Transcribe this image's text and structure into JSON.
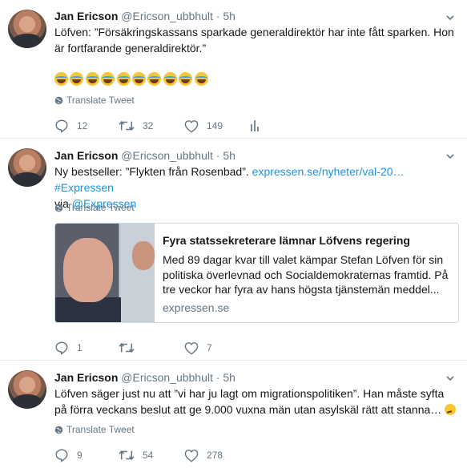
{
  "tweets": [
    {
      "fullname": "Jan Ericson",
      "username": "@Ericson_ubbhult",
      "separator": "·",
      "time": "5h",
      "text": "Löfven: ”Försäkringskassans sparkade generaldirektör har inte fått sparken. Hon är fortfarande generaldirektör.”",
      "emoji_count": 10,
      "translate": "Translate Tweet",
      "replies": "12",
      "retweets": "32",
      "likes": "149"
    },
    {
      "fullname": "Jan Ericson",
      "username": "@Ericson_ubbhult",
      "separator": "·",
      "time": "5h",
      "text_prefix": "Ny bestseller: ”Flykten från Rosenbad”. ",
      "link1": "expressen.se/nyheter/val-20…",
      "hashtag": "#Expressen",
      "text_via": "via ",
      "mention": "@Expressen",
      "translate": "Translate Tweet",
      "card": {
        "title": "Fyra statssekreterare lämnar Löfvens regering",
        "description": "Med 89 dagar kvar till valet kämpar Stefan Löfven för sin politiska överlevnad och Socialdemokraternas framtid. På tre veckor har fyra av hans högsta tjänstemän meddel...",
        "domain": "expressen.se"
      },
      "replies": "1",
      "retweets": "",
      "likes": "7"
    },
    {
      "fullname": "Jan Ericson",
      "username": "@Ericson_ubbhult",
      "separator": "·",
      "time": "5h",
      "text": "Löfven säger just nu att ”vi har ju lagt om migrationspolitiken”. Han måste syfta på förra veckans beslut att ge 9.000 vuxna män utan asylskäl rätt att stanna…",
      "translate": "Translate Tweet",
      "replies": "9",
      "retweets": "54",
      "likes": "278"
    }
  ],
  "colors": {
    "link": "#1b95e0",
    "secondary": "#657786",
    "border": "#e6ecf0"
  },
  "icons": [
    "reply-icon",
    "retweet-icon",
    "like-icon",
    "analytics-icon",
    "globe-icon",
    "chevron-down-icon"
  ]
}
